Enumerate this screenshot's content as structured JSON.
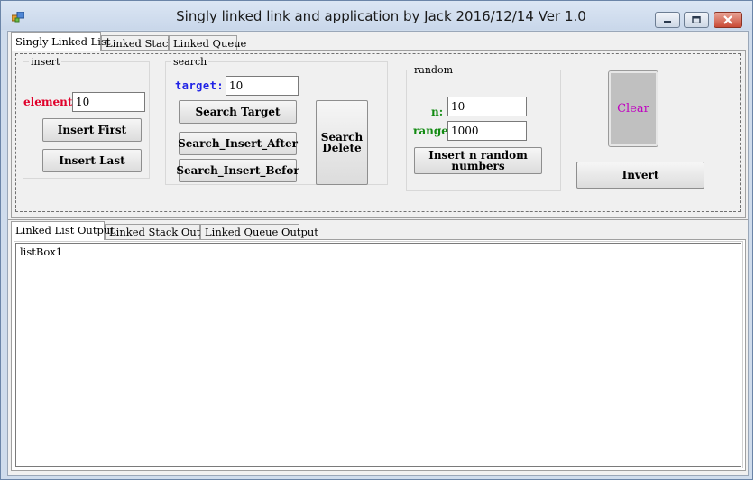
{
  "window": {
    "title": "Singly linked link and application  by Jack 2016/12/14 Ver 1.0",
    "icon": "app-form-icon",
    "controls": [
      "minimize-icon",
      "maximize-icon",
      "close-icon"
    ]
  },
  "top_tabs": [
    "Singly Linked List",
    "Linked Stack",
    "Linked Queue"
  ],
  "insert_group": {
    "title": "insert",
    "element_label": "element:",
    "element_value": "10",
    "insert_first": "Insert First",
    "insert_last": "Insert Last"
  },
  "search_group": {
    "title": "search",
    "target_label": "target:",
    "target_value": "10",
    "search_target": "Search Target",
    "search_insert_after": "Search_Insert_After",
    "search_insert_before": "Search_Insert_Befor",
    "search_delete_line1": "Search",
    "search_delete_line2": "Delete"
  },
  "random_group": {
    "title": "random",
    "n_label": "n:",
    "n_value": "10",
    "range_label": "range:",
    "range_value": "1000",
    "insert_random_line1": "Insert n random",
    "insert_random_line2": "numbers"
  },
  "clear_button": "Clear",
  "invert_button": "Invert",
  "output_tabs": [
    "Linked List Output",
    "Linked Stack Output",
    "Linked Queue Output"
  ],
  "listbox": {
    "text": "listBox1"
  },
  "colors": {
    "element_label": "#e0002a",
    "target_label": "#1f22e6",
    "random_labels": "#118a11",
    "clear_text": "#c000c0",
    "clear_bg": "#c0c0c0"
  }
}
